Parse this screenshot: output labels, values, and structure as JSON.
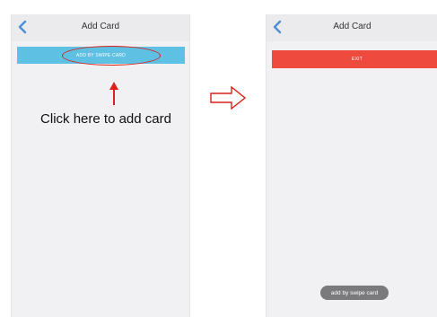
{
  "left_screen": {
    "header_title": "Add Card",
    "swipe_button_label": "ADD BY SWIPE CARD",
    "annotation_text": "Click here to add card"
  },
  "right_screen": {
    "header_title": "Add Card",
    "exit_button_label": "EXIT",
    "toast_text": "add by swipe card"
  },
  "colors": {
    "accent_blue": "#5ec0e3",
    "exit_red": "#ee4b3e",
    "annotation_red": "#d9221a",
    "back_icon": "#4a8fd8"
  },
  "icons": {
    "back": "chevron-left-icon",
    "transition": "arrow-right-outline-icon",
    "pointer": "arrow-up-icon"
  }
}
